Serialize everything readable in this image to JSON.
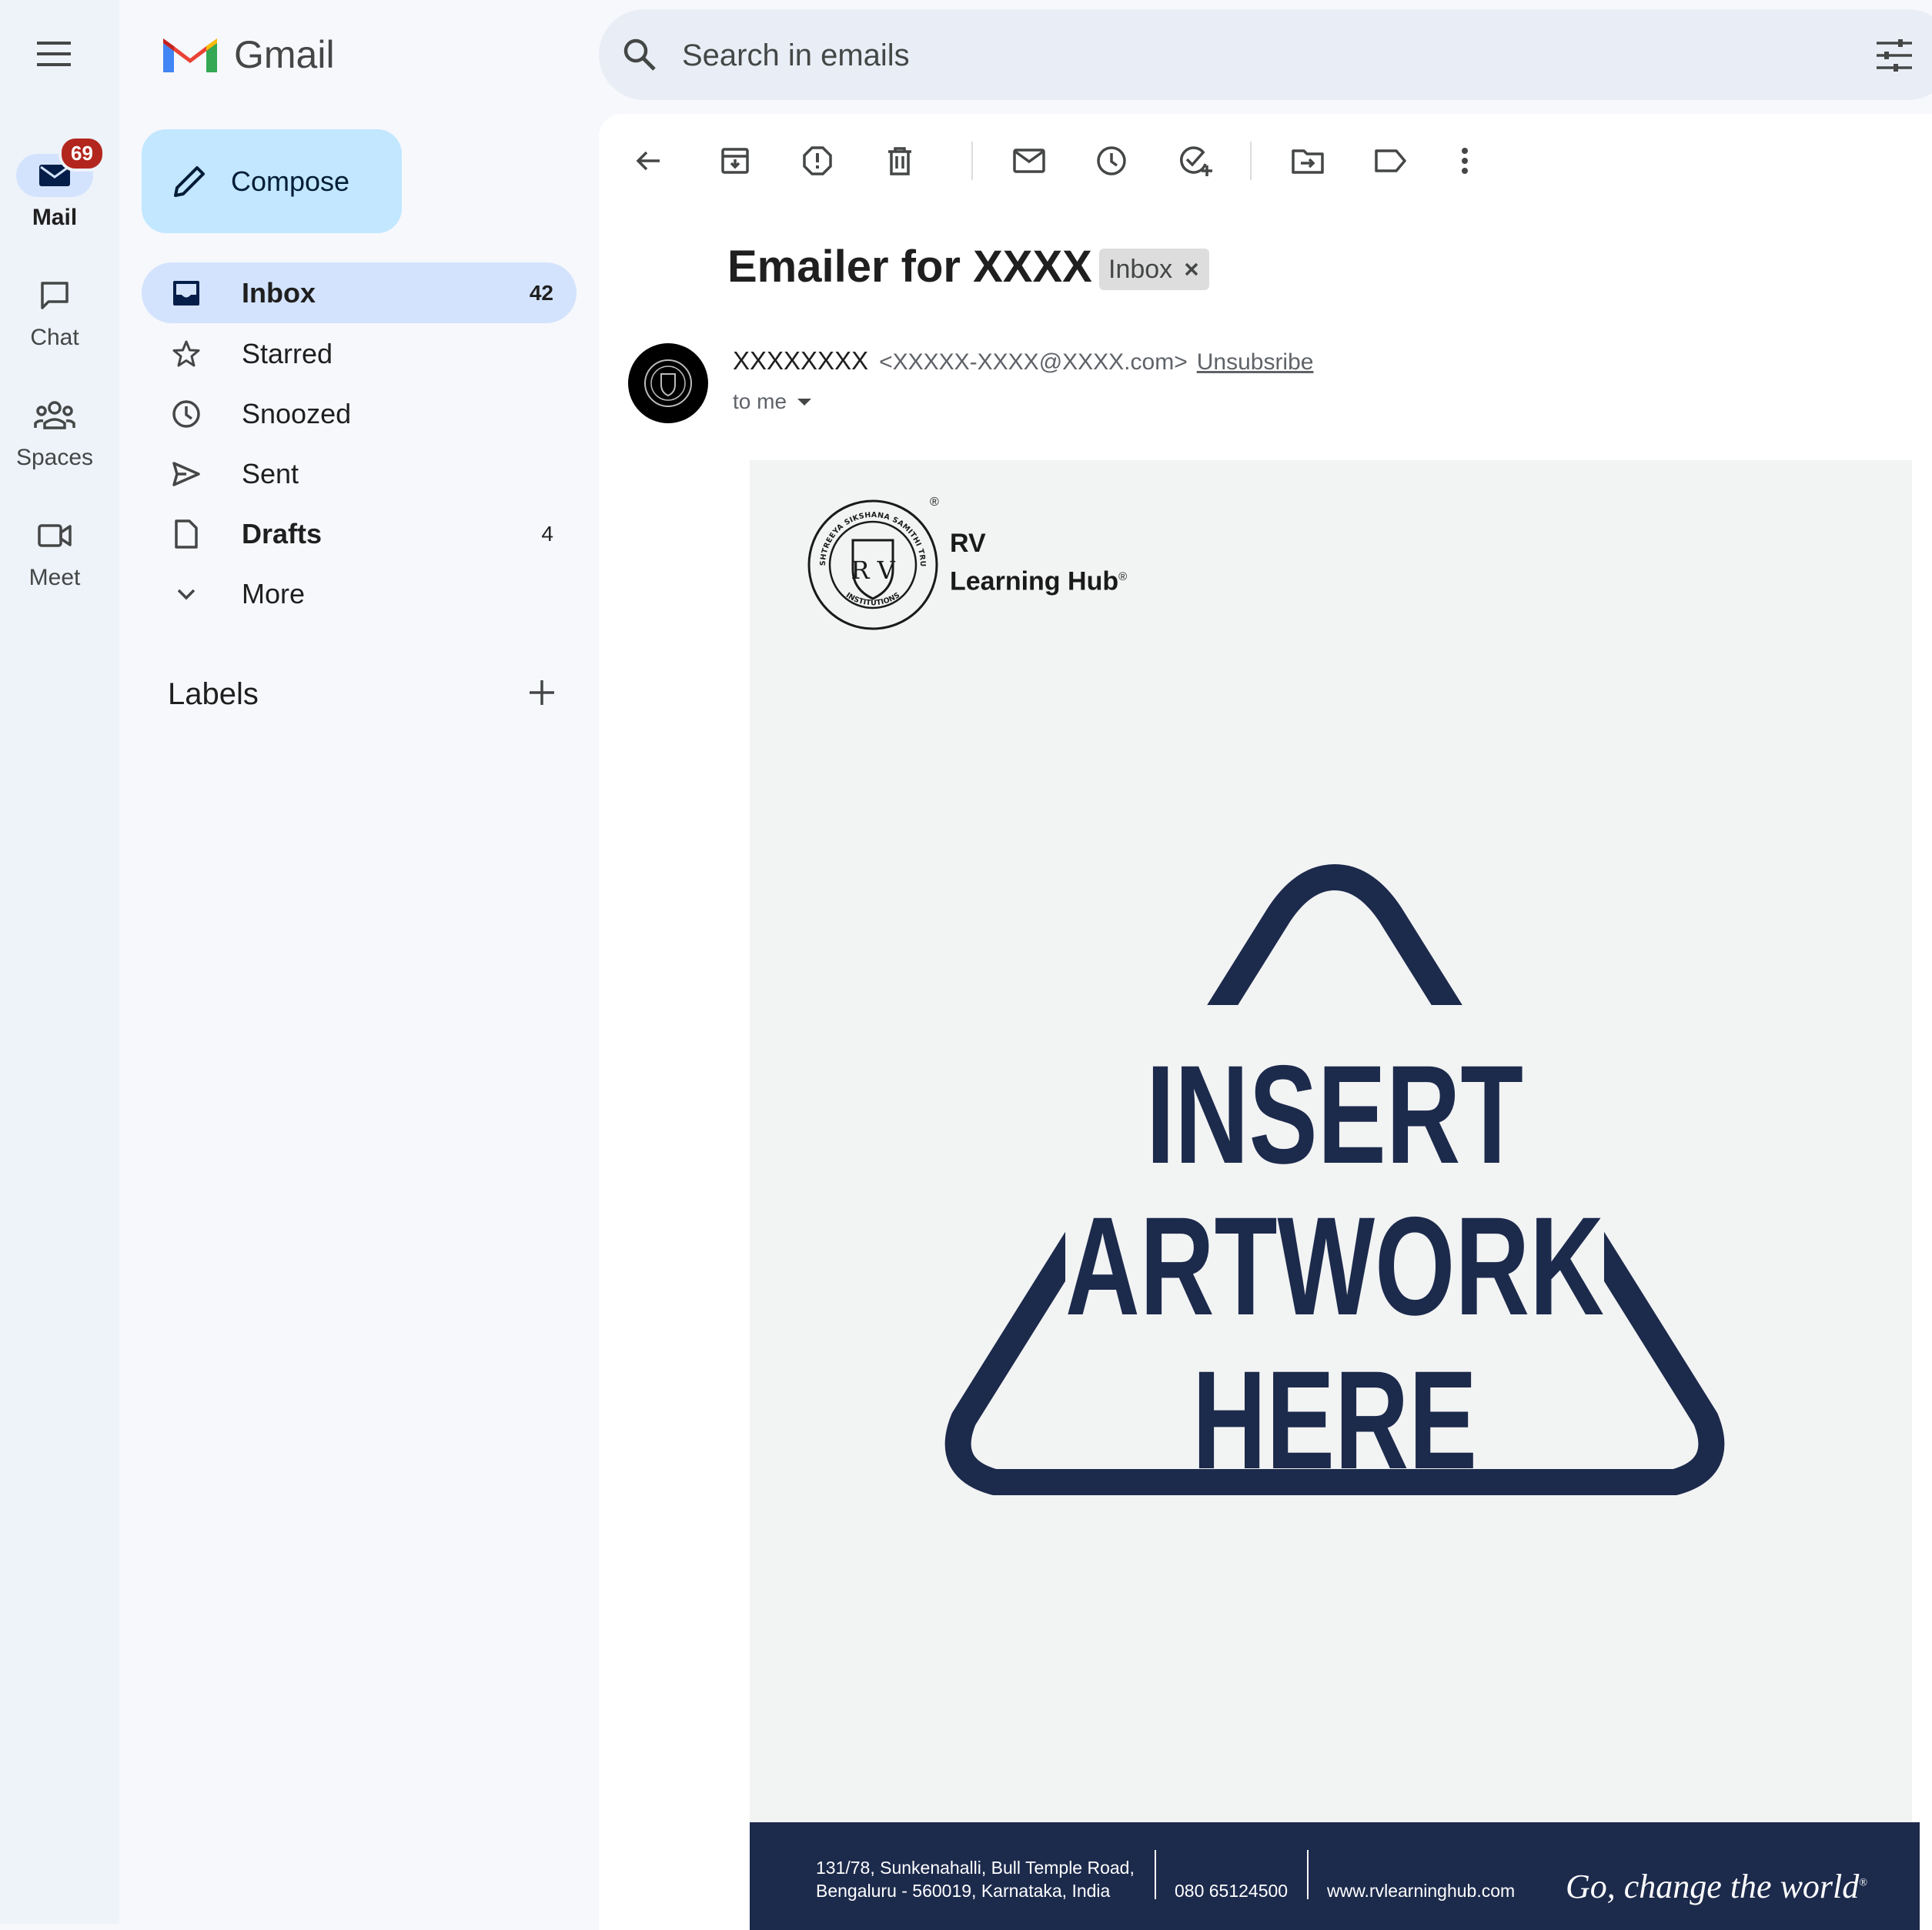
{
  "app": {
    "name": "Gmail",
    "brand_colors": [
      "#ea4335",
      "#4285f4",
      "#34a853",
      "#fbbc04"
    ]
  },
  "rail": {
    "items": [
      {
        "label": "Mail",
        "icon": "mail-icon",
        "badge": "69",
        "active": true
      },
      {
        "label": "Chat",
        "icon": "chat-icon"
      },
      {
        "label": "Spaces",
        "icon": "spaces-icon"
      },
      {
        "label": "Meet",
        "icon": "video-icon"
      }
    ]
  },
  "compose": {
    "label": "Compose"
  },
  "nav": {
    "items": [
      {
        "label": "Inbox",
        "count": "42",
        "icon": "inbox-icon",
        "active": true
      },
      {
        "label": "Starred",
        "count": "",
        "icon": "star-icon"
      },
      {
        "label": "Snoozed",
        "count": "",
        "icon": "clock-icon"
      },
      {
        "label": "Sent",
        "count": "",
        "icon": "send-icon"
      },
      {
        "label": "Drafts",
        "count": "4",
        "icon": "draft-icon"
      },
      {
        "label": "More",
        "count": "",
        "icon": "chevron-down-icon"
      }
    ]
  },
  "labels": {
    "title": "Labels"
  },
  "search": {
    "placeholder": "Search in emails"
  },
  "toolbar": {
    "icons": [
      "back-arrow-icon",
      "archive-icon",
      "report-spam-icon",
      "delete-icon",
      "mark-unread-icon",
      "snooze-icon",
      "add-task-icon",
      "move-to-icon",
      "label-icon",
      "more-vert-icon"
    ]
  },
  "email": {
    "subject": "Emailer for XXXX",
    "label_chip": "Inbox",
    "sender_name": "XXXXXXXX",
    "sender_email": "<XXXXX-XXXX@XXXX.com>",
    "unsubscribe": "Unsubsribe",
    "to": "to me"
  },
  "artwork": {
    "logo_line1": "RV",
    "logo_line2": "Learning Hub",
    "seal_top": "RASHTREEYA SIKSHANA SAMITHI TRUST",
    "seal_bottom": "INSTITUTIONS",
    "seal_center": "R V",
    "registered": "®",
    "headline": [
      "INSERT",
      "ARTWORK",
      "HERE"
    ],
    "accent_color": "#1c2a4c",
    "footer": {
      "address_line1": "131/78, Sunkenahalli, Bull Temple Road,",
      "address_line2": "Bengaluru - 560019, Karnataka, India",
      "phone": "080 65124500",
      "website": "www.rvlearninghub.com",
      "tagline": "Go, change the world"
    }
  }
}
